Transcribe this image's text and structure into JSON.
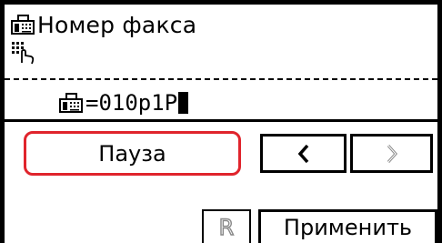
{
  "header": {
    "title": "Номер факса"
  },
  "input": {
    "prefix": "=",
    "value": "010p1P"
  },
  "buttons": {
    "pause_label": "Пауза",
    "apply_label": "Применить",
    "r_label": "R"
  },
  "colors": {
    "accent_border": "#e0242c",
    "foreground": "#000000",
    "disabled": "#888888"
  },
  "icons": {
    "fax": "fax-icon",
    "keypad": "keypad-touch-icon",
    "left": "chevron-left-icon",
    "right": "chevron-right-icon"
  }
}
